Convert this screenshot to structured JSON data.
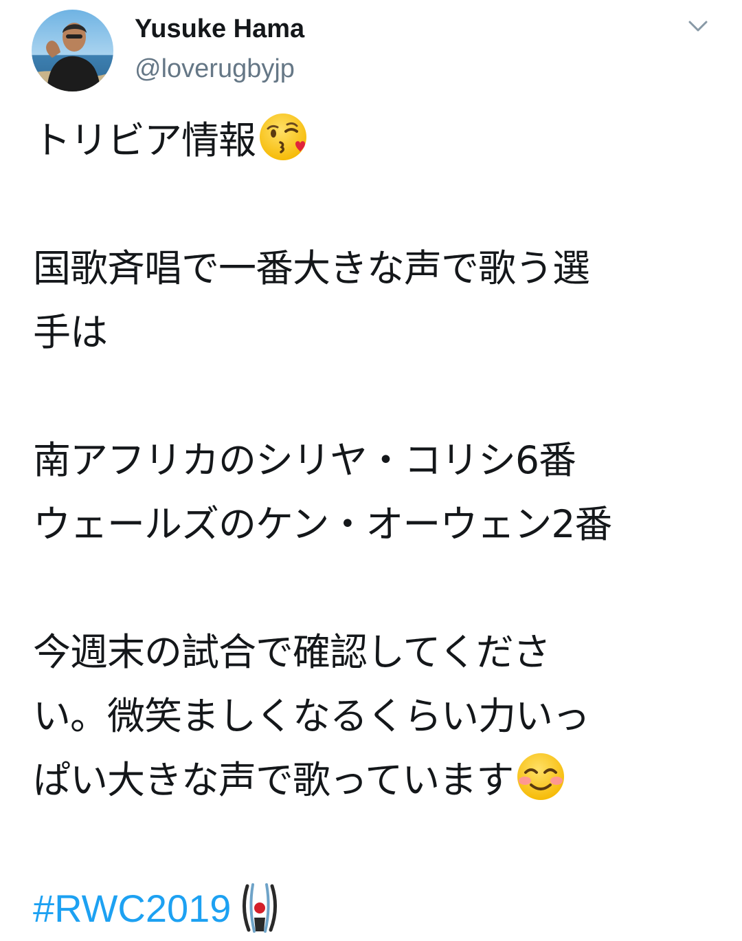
{
  "author": {
    "name": "Yusuke Hama",
    "handle": "@loverugbyjp",
    "avatar_icon": "profile-photo-man-by-sea"
  },
  "menu": {
    "icon": "chevron-down-icon"
  },
  "tweet": {
    "lines": [
      "トリビア情報",
      "",
      "国歌斉唱で一番大きな声で歌う選",
      "手は",
      "",
      "南アフリカのシリヤ・コリシ6番",
      "ウェールズのケン・オーウェン2番",
      "",
      "今週末の試合で確認してくださ",
      "い。微笑ましくなるくらい力いっ",
      "ぱい大きな声で歌っています"
    ],
    "emoji_after_line_0": "face-blowing-a-kiss",
    "emoji_after_line_10": "smiling-face-with-smiling-eyes",
    "hashtag": "#RWC2019",
    "hashtag_icon": "rugby-world-cup-2019-logo"
  },
  "colors": {
    "text": "#14171a",
    "secondary": "#657786",
    "link": "#1da1f2",
    "background": "#ffffff"
  }
}
